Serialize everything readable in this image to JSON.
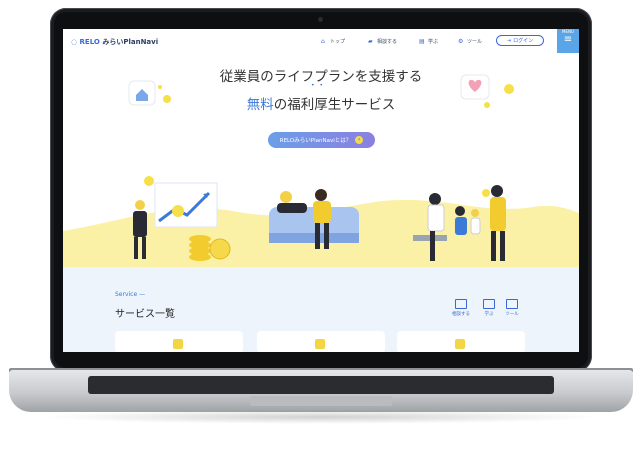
{
  "header": {
    "logo_prefix": "RELO",
    "logo_suffix": "みらいPlanNavi",
    "nav": [
      {
        "label": "トップ",
        "icon": "home-icon"
      },
      {
        "label": "相談する",
        "icon": "chat-icon"
      },
      {
        "label": "学ぶ",
        "icon": "book-icon"
      },
      {
        "label": "ツール",
        "icon": "tool-icon"
      }
    ],
    "login_label": "ログイン",
    "menu_label": "MENU"
  },
  "hero": {
    "title": "従業員のライフプランを支援する",
    "subtitle_highlight": "無料",
    "subtitle_rest": "の福利厚生サービス",
    "cta_label": "RELOみらいPlanNaviとは？"
  },
  "services": {
    "section_label": "Service",
    "section_title": "サービス一覧",
    "nav": [
      {
        "label": "相談する"
      },
      {
        "label": "学ぶ"
      },
      {
        "label": "ツール"
      }
    ]
  },
  "colors": {
    "accent": "#3b68d8",
    "highlight": "#3b7ad8",
    "yellow": "#f5e04a",
    "menu_bg": "#5aa5e8",
    "laptop": "#1b1c1f"
  }
}
